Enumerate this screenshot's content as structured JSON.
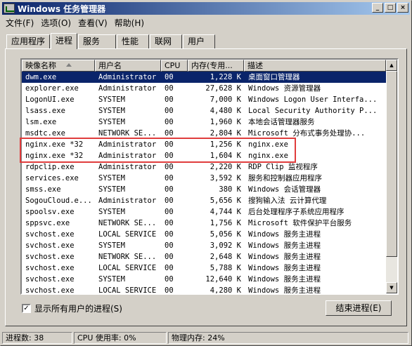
{
  "window": {
    "title": "Windows 任务管理器",
    "buttons": [
      "_",
      "□",
      "×"
    ]
  },
  "menu": [
    "文件(F)",
    "选项(O)",
    "查看(V)",
    "帮助(H)"
  ],
  "tabs": [
    "应用程序",
    "进程",
    "服务",
    "性能",
    "联网",
    "用户"
  ],
  "active_tab": "进程",
  "columns": [
    "映像名称",
    "用户名",
    "CPU",
    "内存(专用...",
    "描述"
  ],
  "processes": [
    {
      "name": "dwm.exe",
      "user": "Administrator",
      "cpu": "00",
      "mem": "1,228 K",
      "desc": "桌面窗口管理器",
      "selected": true
    },
    {
      "name": "explorer.exe",
      "user": "Administrator",
      "cpu": "00",
      "mem": "27,628 K",
      "desc": "Windows 资源管理器"
    },
    {
      "name": "LogonUI.exe",
      "user": "SYSTEM",
      "cpu": "00",
      "mem": "7,000 K",
      "desc": "Windows Logon User Interfa..."
    },
    {
      "name": "lsass.exe",
      "user": "SYSTEM",
      "cpu": "00",
      "mem": "4,480 K",
      "desc": "Local Security Authority P..."
    },
    {
      "name": "lsm.exe",
      "user": "SYSTEM",
      "cpu": "00",
      "mem": "1,960 K",
      "desc": "本地会话管理器服务"
    },
    {
      "name": "msdtc.exe",
      "user": "NETWORK SE...",
      "cpu": "00",
      "mem": "2,804 K",
      "desc": "Microsoft 分布式事务处理协..."
    },
    {
      "name": "nginx.exe *32",
      "user": "Administrator",
      "cpu": "00",
      "mem": "1,256 K",
      "desc": "nginx.exe"
    },
    {
      "name": "nginx.exe *32",
      "user": "Administrator",
      "cpu": "00",
      "mem": "1,604 K",
      "desc": "nginx.exe"
    },
    {
      "name": "rdpclip.exe",
      "user": "Administrator",
      "cpu": "00",
      "mem": "2,220 K",
      "desc": "RDP Clip 监视程序"
    },
    {
      "name": "services.exe",
      "user": "SYSTEM",
      "cpu": "00",
      "mem": "3,592 K",
      "desc": "服务和控制器应用程序"
    },
    {
      "name": "smss.exe",
      "user": "SYSTEM",
      "cpu": "00",
      "mem": "380 K",
      "desc": "Windows 会话管理器"
    },
    {
      "name": "SogouCloud.e...",
      "user": "Administrator",
      "cpu": "00",
      "mem": "5,656 K",
      "desc": "搜狗输入法 云计算代理"
    },
    {
      "name": "spoolsv.exe",
      "user": "SYSTEM",
      "cpu": "00",
      "mem": "4,744 K",
      "desc": "后台处理程序子系统应用程序"
    },
    {
      "name": "sppsvc.exe",
      "user": "NETWORK SE...",
      "cpu": "00",
      "mem": "1,756 K",
      "desc": "Microsoft 软件保护平台服务"
    },
    {
      "name": "svchost.exe",
      "user": "LOCAL SERVICE",
      "cpu": "00",
      "mem": "5,056 K",
      "desc": "Windows 服务主进程"
    },
    {
      "name": "svchost.exe",
      "user": "SYSTEM",
      "cpu": "00",
      "mem": "3,092 K",
      "desc": "Windows 服务主进程"
    },
    {
      "name": "svchost.exe",
      "user": "NETWORK SE...",
      "cpu": "00",
      "mem": "2,648 K",
      "desc": "Windows 服务主进程"
    },
    {
      "name": "svchost.exe",
      "user": "LOCAL SERVICE",
      "cpu": "00",
      "mem": "5,788 K",
      "desc": "Windows 服务主进程"
    },
    {
      "name": "svchost.exe",
      "user": "SYSTEM",
      "cpu": "00",
      "mem": "12,640 K",
      "desc": "Windows 服务主进程"
    },
    {
      "name": "svchost.exe",
      "user": "LOCAL SERVICE",
      "cpu": "00",
      "mem": "4,280 K",
      "desc": "Windows 服务主进程"
    }
  ],
  "highlight_color": "#e03c3c",
  "show_all_users": {
    "label": "显示所有用户的进程(S)",
    "checked": "✓"
  },
  "end_process_button": "结束进程(E)",
  "status": {
    "processes": "进程数: 38",
    "cpu": "CPU 使用率: 0%",
    "memory": "物理内存: 24%"
  }
}
